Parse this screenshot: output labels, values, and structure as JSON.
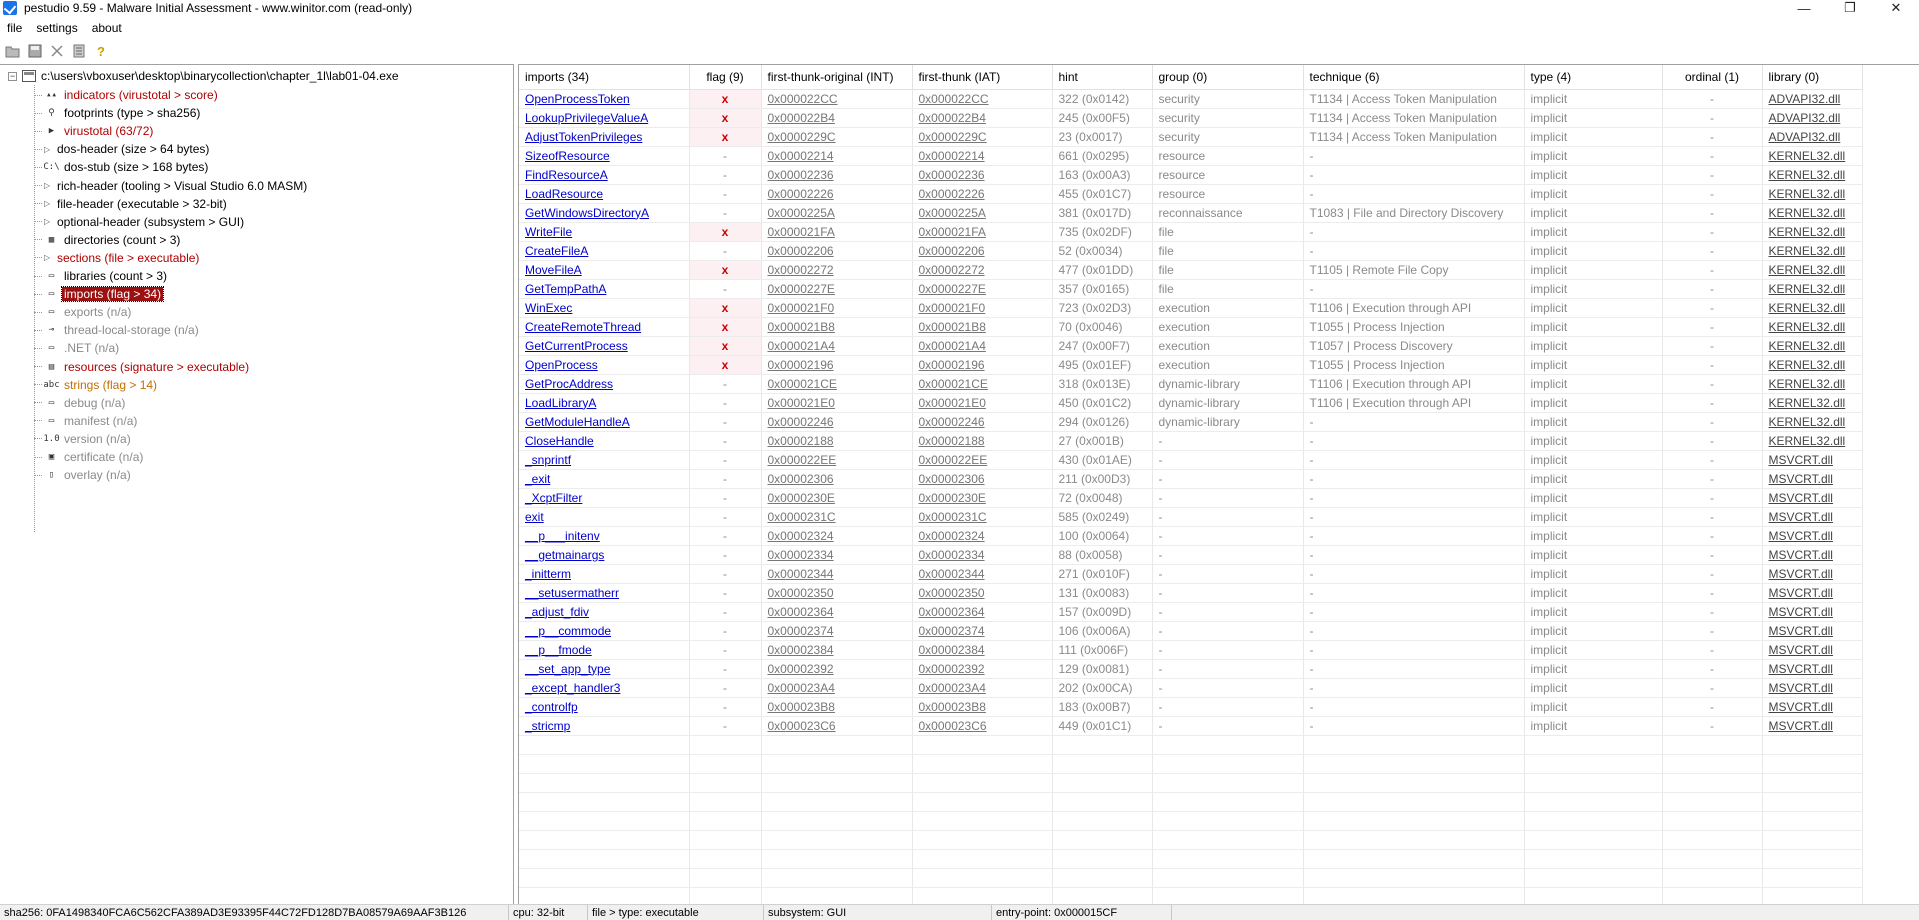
{
  "window": {
    "title": "pestudio 9.59 - Malware Initial Assessment - www.winitor.com (read-only)",
    "controls": [
      "—",
      "❐",
      "✕"
    ]
  },
  "menu": [
    "file",
    "settings",
    "about"
  ],
  "toolbar": [
    "open-icon",
    "save-icon",
    "cut-icon",
    "list-icon",
    "help-icon"
  ],
  "tree": {
    "root": "c:\\users\\vboxuser\\desktop\\binarycollection\\chapter_1l\\lab01-04.exe",
    "items": [
      {
        "label": "indicators (virustotal > score)",
        "color": "red",
        "chev": false,
        "icon": "indicators-icon",
        "glyph": "▴▴"
      },
      {
        "label": "footprints (type > sha256)",
        "color": "black",
        "chev": false,
        "icon": "footprints-icon",
        "glyph": "⚲"
      },
      {
        "label": "virustotal (63/72)",
        "color": "red",
        "chev": false,
        "icon": "virustotal-icon",
        "glyph": "▶"
      },
      {
        "label": "dos-header (size > 64 bytes)",
        "color": "black",
        "chev": true,
        "icon": "",
        "glyph": ""
      },
      {
        "label": "dos-stub (size > 168 bytes)",
        "color": "black",
        "chev": false,
        "icon": "dos-stub-icon",
        "glyph": "C:\\"
      },
      {
        "label": "rich-header (tooling > Visual Studio 6.0 MASM)",
        "color": "black",
        "chev": true,
        "icon": "",
        "glyph": ""
      },
      {
        "label": "file-header (executable > 32-bit)",
        "color": "black",
        "chev": true,
        "icon": "",
        "glyph": ""
      },
      {
        "label": "optional-header (subsystem > GUI)",
        "color": "black",
        "chev": true,
        "icon": "",
        "glyph": ""
      },
      {
        "label": "directories (count > 3)",
        "color": "black",
        "chev": false,
        "icon": "directories-icon",
        "glyph": "▦"
      },
      {
        "label": "sections (file > executable)",
        "color": "red",
        "chev": true,
        "icon": "",
        "glyph": ""
      },
      {
        "label": "libraries (count > 3)",
        "color": "black",
        "chev": false,
        "icon": "libraries-icon",
        "glyph": "▭"
      },
      {
        "label": "imports (flag > 34)",
        "color": "selected",
        "chev": false,
        "icon": "imports-icon",
        "glyph": "▭"
      },
      {
        "label": "exports (n/a)",
        "color": "gray",
        "chev": false,
        "icon": "exports-icon",
        "glyph": "▭"
      },
      {
        "label": "thread-local-storage (n/a)",
        "color": "gray",
        "chev": false,
        "icon": "tls-icon",
        "glyph": "⊸"
      },
      {
        "label": ".NET (n/a)",
        "color": "gray",
        "chev": false,
        "icon": "dotnet-icon",
        "glyph": "▭"
      },
      {
        "label": "resources (signature > executable)",
        "color": "red",
        "chev": false,
        "icon": "resources-icon",
        "glyph": "▤"
      },
      {
        "label": "strings (flag > 14)",
        "color": "orange",
        "chev": false,
        "icon": "strings-icon",
        "glyph": "abc"
      },
      {
        "label": "debug (n/a)",
        "color": "gray",
        "chev": false,
        "icon": "debug-icon",
        "glyph": "▭"
      },
      {
        "label": "manifest (n/a)",
        "color": "gray",
        "chev": false,
        "icon": "manifest-icon",
        "glyph": "▭"
      },
      {
        "label": "version (n/a)",
        "color": "gray",
        "chev": false,
        "icon": "version-icon",
        "glyph": "1.0"
      },
      {
        "label": "certificate (n/a)",
        "color": "gray",
        "chev": false,
        "icon": "certificate-icon",
        "glyph": "▣"
      },
      {
        "label": "overlay (n/a)",
        "color": "gray",
        "chev": false,
        "icon": "overlay-icon",
        "glyph": "▯"
      }
    ]
  },
  "table": {
    "columns": [
      "imports (34)",
      "flag (9)",
      "first-thunk-original (INT)",
      "first-thunk (IAT)",
      "hint",
      "group (0)",
      "technique (6)",
      "type (4)",
      "ordinal (1)",
      "library (0)"
    ],
    "rows": [
      [
        "OpenProcessToken",
        "x",
        "0x000022CC",
        "0x000022CC",
        "322 (0x0142)",
        "security",
        "T1134 | Access Token Manipulation",
        "implicit",
        "-",
        "ADVAPI32.dll"
      ],
      [
        "LookupPrivilegeValueA",
        "x",
        "0x000022B4",
        "0x000022B4",
        "245 (0x00F5)",
        "security",
        "T1134 | Access Token Manipulation",
        "implicit",
        "-",
        "ADVAPI32.dll"
      ],
      [
        "AdjustTokenPrivileges",
        "x",
        "0x0000229C",
        "0x0000229C",
        "23 (0x0017)",
        "security",
        "T1134 | Access Token Manipulation",
        "implicit",
        "-",
        "ADVAPI32.dll"
      ],
      [
        "SizeofResource",
        "-",
        "0x00002214",
        "0x00002214",
        "661 (0x0295)",
        "resource",
        "-",
        "implicit",
        "-",
        "KERNEL32.dll"
      ],
      [
        "FindResourceA",
        "-",
        "0x00002236",
        "0x00002236",
        "163 (0x00A3)",
        "resource",
        "-",
        "implicit",
        "-",
        "KERNEL32.dll"
      ],
      [
        "LoadResource",
        "-",
        "0x00002226",
        "0x00002226",
        "455 (0x01C7)",
        "resource",
        "-",
        "implicit",
        "-",
        "KERNEL32.dll"
      ],
      [
        "GetWindowsDirectoryA",
        "-",
        "0x0000225A",
        "0x0000225A",
        "381 (0x017D)",
        "reconnaissance",
        "T1083 | File and Directory Discovery",
        "implicit",
        "-",
        "KERNEL32.dll"
      ],
      [
        "WriteFile",
        "x",
        "0x000021FA",
        "0x000021FA",
        "735 (0x02DF)",
        "file",
        "-",
        "implicit",
        "-",
        "KERNEL32.dll"
      ],
      [
        "CreateFileA",
        "-",
        "0x00002206",
        "0x00002206",
        "52 (0x0034)",
        "file",
        "-",
        "implicit",
        "-",
        "KERNEL32.dll"
      ],
      [
        "MoveFileA",
        "x",
        "0x00002272",
        "0x00002272",
        "477 (0x01DD)",
        "file",
        "T1105 | Remote File Copy",
        "implicit",
        "-",
        "KERNEL32.dll"
      ],
      [
        "GetTempPathA",
        "-",
        "0x0000227E",
        "0x0000227E",
        "357 (0x0165)",
        "file",
        "-",
        "implicit",
        "-",
        "KERNEL32.dll"
      ],
      [
        "WinExec",
        "x",
        "0x000021F0",
        "0x000021F0",
        "723 (0x02D3)",
        "execution",
        "T1106 | Execution through API",
        "implicit",
        "-",
        "KERNEL32.dll"
      ],
      [
        "CreateRemoteThread",
        "x",
        "0x000021B8",
        "0x000021B8",
        "70 (0x0046)",
        "execution",
        "T1055 | Process Injection",
        "implicit",
        "-",
        "KERNEL32.dll"
      ],
      [
        "GetCurrentProcess",
        "x",
        "0x000021A4",
        "0x000021A4",
        "247 (0x00F7)",
        "execution",
        "T1057 | Process Discovery",
        "implicit",
        "-",
        "KERNEL32.dll"
      ],
      [
        "OpenProcess",
        "x",
        "0x00002196",
        "0x00002196",
        "495 (0x01EF)",
        "execution",
        "T1055 | Process Injection",
        "implicit",
        "-",
        "KERNEL32.dll"
      ],
      [
        "GetProcAddress",
        "-",
        "0x000021CE",
        "0x000021CE",
        "318 (0x013E)",
        "dynamic-library",
        "T1106 | Execution through API",
        "implicit",
        "-",
        "KERNEL32.dll"
      ],
      [
        "LoadLibraryA",
        "-",
        "0x000021E0",
        "0x000021E0",
        "450 (0x01C2)",
        "dynamic-library",
        "T1106 | Execution through API",
        "implicit",
        "-",
        "KERNEL32.dll"
      ],
      [
        "GetModuleHandleA",
        "-",
        "0x00002246",
        "0x00002246",
        "294 (0x0126)",
        "dynamic-library",
        "-",
        "implicit",
        "-",
        "KERNEL32.dll"
      ],
      [
        "CloseHandle",
        "-",
        "0x00002188",
        "0x00002188",
        "27 (0x001B)",
        "-",
        "-",
        "implicit",
        "-",
        "KERNEL32.dll"
      ],
      [
        "_snprintf",
        "-",
        "0x000022EE",
        "0x000022EE",
        "430 (0x01AE)",
        "-",
        "-",
        "implicit",
        "-",
        "MSVCRT.dll"
      ],
      [
        "_exit",
        "-",
        "0x00002306",
        "0x00002306",
        "211 (0x00D3)",
        "-",
        "-",
        "implicit",
        "-",
        "MSVCRT.dll"
      ],
      [
        "_XcptFilter",
        "-",
        "0x0000230E",
        "0x0000230E",
        "72 (0x0048)",
        "-",
        "-",
        "implicit",
        "-",
        "MSVCRT.dll"
      ],
      [
        "exit",
        "-",
        "0x0000231C",
        "0x0000231C",
        "585 (0x0249)",
        "-",
        "-",
        "implicit",
        "-",
        "MSVCRT.dll"
      ],
      [
        "__p___initenv",
        "-",
        "0x00002324",
        "0x00002324",
        "100 (0x0064)",
        "-",
        "-",
        "implicit",
        "-",
        "MSVCRT.dll"
      ],
      [
        "__getmainargs",
        "-",
        "0x00002334",
        "0x00002334",
        "88 (0x0058)",
        "-",
        "-",
        "implicit",
        "-",
        "MSVCRT.dll"
      ],
      [
        "_initterm",
        "-",
        "0x00002344",
        "0x00002344",
        "271 (0x010F)",
        "-",
        "-",
        "implicit",
        "-",
        "MSVCRT.dll"
      ],
      [
        "__setusermatherr",
        "-",
        "0x00002350",
        "0x00002350",
        "131 (0x0083)",
        "-",
        "-",
        "implicit",
        "-",
        "MSVCRT.dll"
      ],
      [
        "_adjust_fdiv",
        "-",
        "0x00002364",
        "0x00002364",
        "157 (0x009D)",
        "-",
        "-",
        "implicit",
        "-",
        "MSVCRT.dll"
      ],
      [
        "__p__commode",
        "-",
        "0x00002374",
        "0x00002374",
        "106 (0x006A)",
        "-",
        "-",
        "implicit",
        "-",
        "MSVCRT.dll"
      ],
      [
        "__p__fmode",
        "-",
        "0x00002384",
        "0x00002384",
        "111 (0x006F)",
        "-",
        "-",
        "implicit",
        "-",
        "MSVCRT.dll"
      ],
      [
        "__set_app_type",
        "-",
        "0x00002392",
        "0x00002392",
        "129 (0x0081)",
        "-",
        "-",
        "implicit",
        "-",
        "MSVCRT.dll"
      ],
      [
        "_except_handler3",
        "-",
        "0x000023A4",
        "0x000023A4",
        "202 (0x00CA)",
        "-",
        "-",
        "implicit",
        "-",
        "MSVCRT.dll"
      ],
      [
        "_controlfp",
        "-",
        "0x000023B8",
        "0x000023B8",
        "183 (0x00B7)",
        "-",
        "-",
        "implicit",
        "-",
        "MSVCRT.dll"
      ],
      [
        "_stricmp",
        "-",
        "0x000023C6",
        "0x000023C6",
        "449 (0x01C1)",
        "-",
        "-",
        "implicit",
        "-",
        "MSVCRT.dll"
      ]
    ]
  },
  "status": {
    "sha256": "sha256: 0FA1498340FCA6C562CFA389AD3E93395F44C72FD128D7BA08579A69AAF3B126",
    "cpu": "cpu: 32-bit",
    "file_type": "file > type: executable",
    "subsystem": "subsystem: GUI",
    "entry_point": "entry-point: 0x000015CF"
  },
  "colors": {
    "selected_bg": "#9b1010",
    "flag_red": "#cc0000",
    "link_blue": "#0000cc",
    "red_text": "#b00000",
    "orange_text": "#c07000"
  }
}
